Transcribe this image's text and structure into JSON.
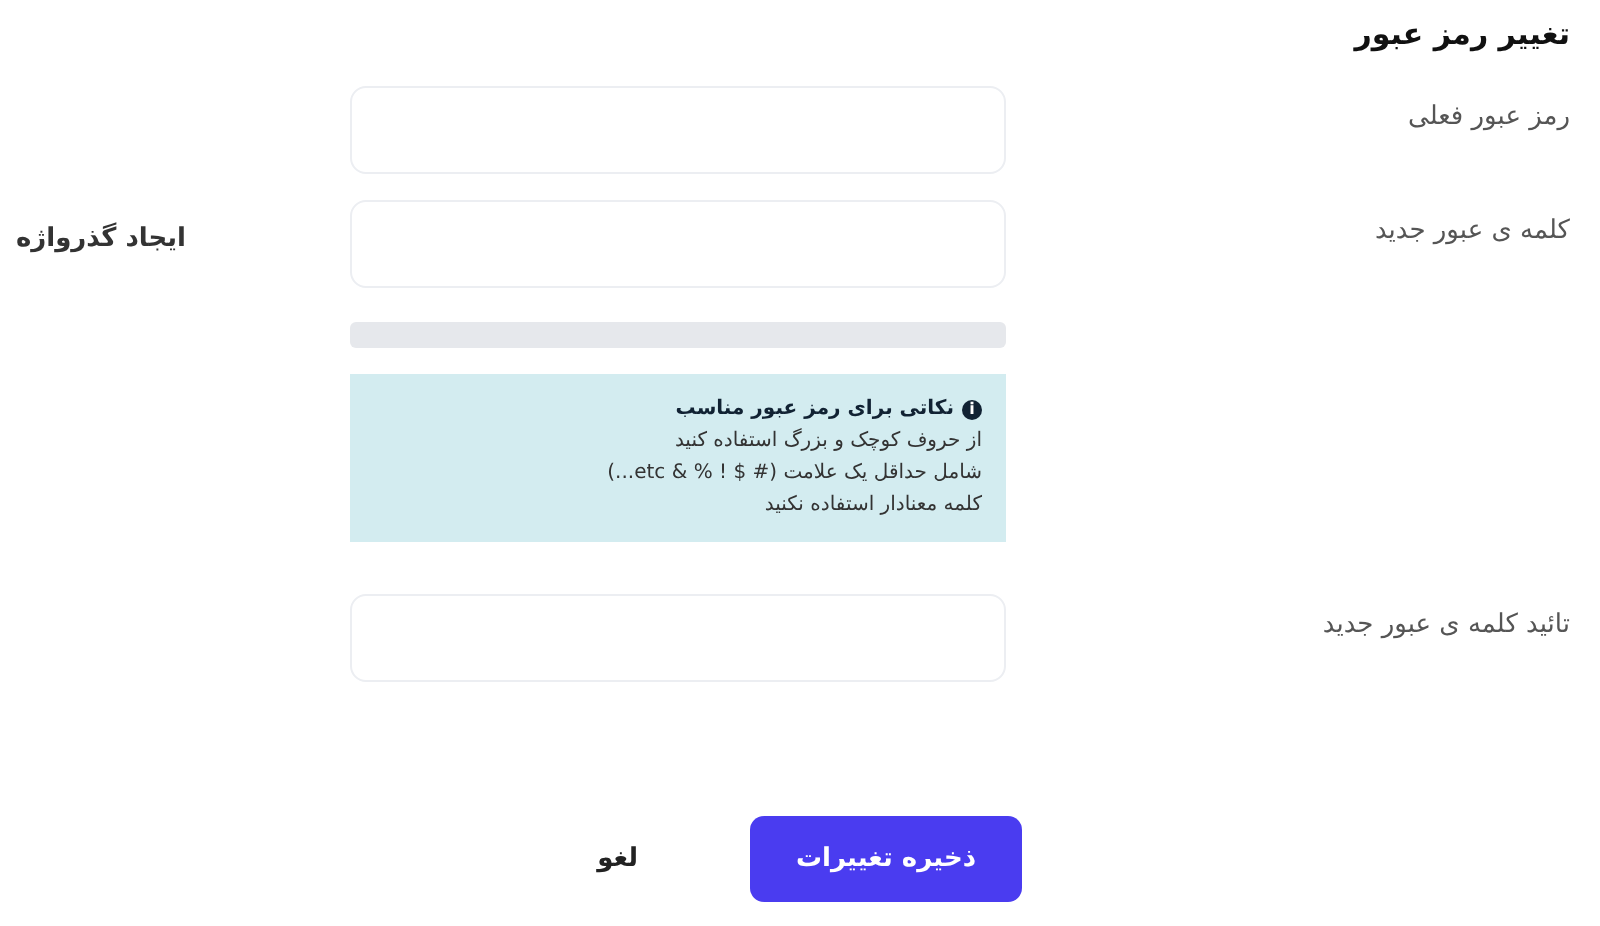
{
  "title": "تغییر رمز عبور",
  "fields": [
    {
      "label": "رمز عبور فعلی"
    },
    {
      "label": "کلمه ی عبور جدید",
      "generate_link": "ایجاد گذرواژه"
    }
  ],
  "strength": {
    "level": 0
  },
  "tips": {
    "icon": "i",
    "heading": "نکاتی برای رمز عبور مناسب",
    "items": [
      "از حروف کوچک و بزرگ استفاده کنید",
      "شامل حداقل یک علامت (# $ ! % & etc...)",
      "کلمه معنادار استفاده نکنید"
    ]
  },
  "confirm": {
    "label": "تائید کلمه ی عبور جدید"
  },
  "buttons": {
    "save": "ذخیره تغییرات",
    "cancel": "لغو"
  }
}
